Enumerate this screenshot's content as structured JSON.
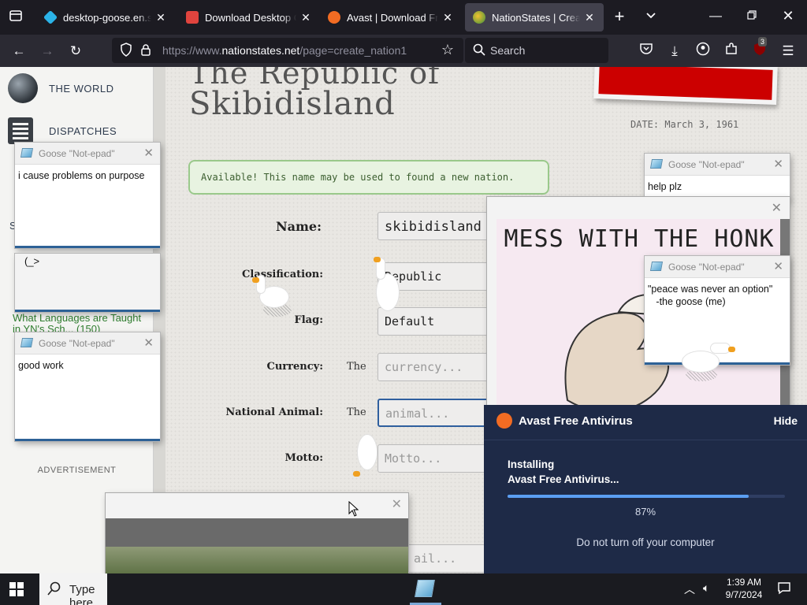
{
  "browser": {
    "tabs": [
      {
        "title": "desktop-goose.en.softonic",
        "favicon_color": "#2bb3e8",
        "active": false
      },
      {
        "title": "Download Desktop Goose",
        "favicon_color": "#e0443e",
        "active": false
      },
      {
        "title": "Avast | Download Free Antivirus",
        "favicon_color": "#f26c23",
        "active": false
      },
      {
        "title": "NationStates | Create a Nation",
        "favicon_color": "#f2c230",
        "active": true
      }
    ],
    "url_prefix": "https://www.",
    "url_domain": "nationstates.net",
    "url_path": "/page=create_nation1",
    "search_placeholder": "Search",
    "extension_badge": "3"
  },
  "sidebar": {
    "world_label": "THE WORLD",
    "dispatches_label": "DISPATCHES",
    "partial_letter": "S",
    "link_text": "What Languages are Taught in YN's Sch... (150)",
    "advertisement": "ADVERTISEMENT"
  },
  "nation_form": {
    "title_line1": "The Republic of",
    "title_line2": "Skibidisland",
    "date_stamp": "DATE: March 3, 1961",
    "availability_message": "Available! This name may be used to found a new nation.",
    "fields": [
      {
        "label": "Name:",
        "value": "skibidisland",
        "prefix": ""
      },
      {
        "label": "Classification:",
        "value": "Republic",
        "prefix": ""
      },
      {
        "label": "Flag:",
        "value": "Default",
        "prefix": ""
      },
      {
        "label": "Currency:",
        "placeholder": "currency...",
        "prefix": "The"
      },
      {
        "label": "National Animal:",
        "placeholder": "animal...",
        "prefix": "The"
      },
      {
        "label": "Motto:",
        "placeholder": "Motto...",
        "prefix": ""
      }
    ],
    "email_placeholder": "ail..."
  },
  "goose_notes": [
    {
      "title": "Goose \"Not-epad\"",
      "text": "i cause problems on purpose"
    },
    {
      "title": "Goose \"Not-epad\"",
      "text": "good work"
    },
    {
      "title": "Goose \"Not-epad\"",
      "text": "help plz"
    },
    {
      "title": "Goose \"Not-epad\"",
      "text": "\"peace was never an option\"\n   -the goose (me)"
    }
  ],
  "sticky_text": "(_>",
  "meme": {
    "text": "MESS WITH THE HONK"
  },
  "avast": {
    "title": "Avast Free Antivirus",
    "hide": "Hide",
    "installing_line1": "Installing",
    "installing_line2": "Avast Free Antivirus...",
    "progress": 0.87,
    "percent_text": "87%",
    "note": "Do not turn off your computer"
  },
  "taskbar": {
    "search_placeholder": "Type here",
    "time": "1:39 AM",
    "date": "9/7/2024"
  }
}
